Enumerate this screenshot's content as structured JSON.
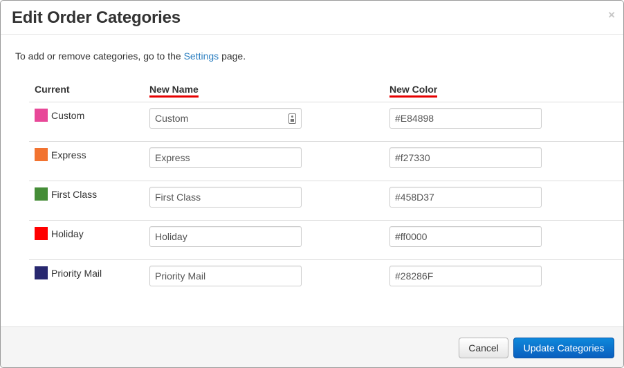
{
  "dialog": {
    "title": "Edit Order Categories",
    "close_glyph": "×"
  },
  "intro": {
    "before": "To add or remove categories, go to the ",
    "link": "Settings",
    "after": " page."
  },
  "columns": {
    "current": "Current",
    "new_name": "New Name",
    "new_color": "New Color"
  },
  "rows": [
    {
      "current": "Custom",
      "swatch": "#E84898",
      "name": "Custom",
      "color": "#E84898"
    },
    {
      "current": "Express",
      "swatch": "#f27330",
      "name": "Express",
      "color": "#f27330"
    },
    {
      "current": "First Class",
      "swatch": "#458D37",
      "name": "First Class",
      "color": "#458D37"
    },
    {
      "current": "Holiday",
      "swatch": "#ff0000",
      "name": "Holiday",
      "color": "#ff0000"
    },
    {
      "current": "Priority Mail",
      "swatch": "#28286F",
      "name": "Priority Mail",
      "color": "#28286F"
    }
  ],
  "footer": {
    "cancel": "Cancel",
    "submit": "Update Categories"
  },
  "icons": {
    "first_name_field": "password-manager-icon",
    "close": "close-icon"
  },
  "theme": {
    "link": "#2c7fc1",
    "primary_button": "#0a6fd0",
    "header_underline": "#e60000"
  }
}
